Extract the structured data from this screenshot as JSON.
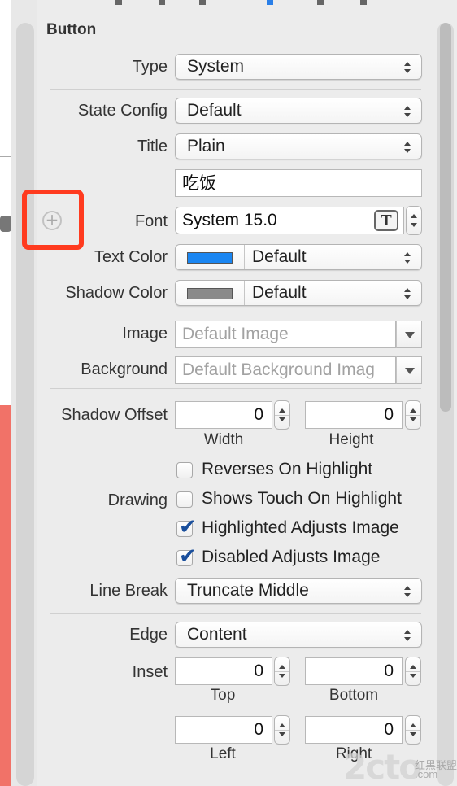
{
  "section": {
    "title": "Button"
  },
  "type": {
    "label": "Type",
    "value": "System"
  },
  "state_config": {
    "label": "State Config",
    "value": "Default"
  },
  "title": {
    "label": "Title",
    "value": "Plain",
    "text": "吃饭"
  },
  "font": {
    "label": "Font",
    "value": "System 15.0",
    "icon_glyph": "T"
  },
  "text_color": {
    "label": "Text Color",
    "value": "Default",
    "swatch": "#1a86f2"
  },
  "shadow_color": {
    "label": "Shadow Color",
    "value": "Default",
    "swatch": "#8a8a8a"
  },
  "image": {
    "label": "Image",
    "placeholder": "Default Image"
  },
  "background": {
    "label": "Background",
    "placeholder": "Default Background Imag"
  },
  "shadow_offset": {
    "label": "Shadow Offset",
    "width": "0",
    "height": "0",
    "width_label": "Width",
    "height_label": "Height"
  },
  "drawing": {
    "label": "Drawing",
    "options": [
      {
        "label": "Reverses On Highlight",
        "checked": false
      },
      {
        "label": "Shows Touch On Highlight",
        "checked": false
      },
      {
        "label": "Highlighted Adjusts Image",
        "checked": true
      },
      {
        "label": "Disabled Adjusts Image",
        "checked": true
      }
    ]
  },
  "line_break": {
    "label": "Line Break",
    "value": "Truncate Middle"
  },
  "edge": {
    "label": "Edge",
    "value": "Content"
  },
  "inset": {
    "label": "Inset",
    "top": "0",
    "bottom": "0",
    "left": "0",
    "right": "0",
    "top_label": "Top",
    "bottom_label": "Bottom",
    "left_label": "Left",
    "right_label": "Right"
  },
  "watermark": {
    "main": "2cto",
    "domain": ".com",
    "chinese": "红黑联盟"
  },
  "colors": {
    "highlight_box": "#ff3b1f",
    "canvas_salmon": "#f17268"
  }
}
